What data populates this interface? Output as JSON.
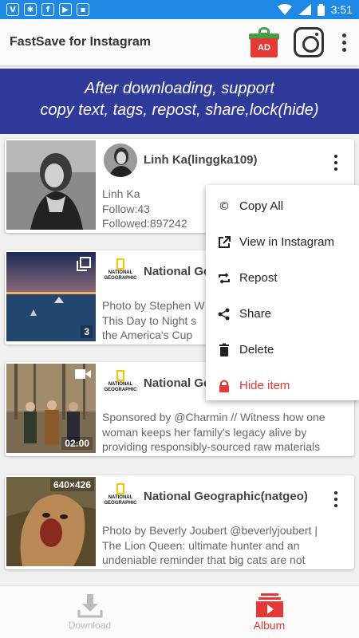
{
  "status_bar": {
    "time": "3:51"
  },
  "app_bar": {
    "title": "FastSave for Instagram",
    "gift_badge": "AD"
  },
  "banner": {
    "line1": "After downloading, support",
    "line2": "copy text, tags, repost, share,lock(hide)"
  },
  "posts": [
    {
      "user": "Linh Ka(linggka109)",
      "lines": [
        "Linh Ka",
        "Follow:43",
        "Followed:897242"
      ]
    },
    {
      "user": "National Geographic(natgeo)",
      "user_visible": "National Ge",
      "lines": [
        "Photo by Stephen W",
        "This Day to Night s",
        "the America's Cup"
      ],
      "badge": "3"
    },
    {
      "user": "National Geographic(natgeo)",
      "user_visible": "National Ge",
      "lines": [
        "Sponsored by @Charmin // Witness how one",
        "woman keeps her family's legacy alive by",
        "providing responsibly-sourced raw materials"
      ],
      "badge": "02:00"
    },
    {
      "user": "National Geographic(natgeo)",
      "lines": [
        "Photo by Beverly Joubert @beverlyjoubert |",
        "The Lion Queen:  ultimate hunter and an",
        "undeniable reminder that big cats are not"
      ],
      "badge": "640×426"
    }
  ],
  "natgeo_logo_text": "NATIONAL GEOGRAPHIC",
  "menu": {
    "items": [
      {
        "label": "Copy All",
        "icon": "copyright-icon"
      },
      {
        "label": "View in Instagram",
        "icon": "external-link-icon"
      },
      {
        "label": "Repost",
        "icon": "repost-icon"
      },
      {
        "label": "Share",
        "icon": "share-icon"
      },
      {
        "label": "Delete",
        "icon": "trash-icon"
      },
      {
        "label": "Hide item",
        "icon": "lock-icon"
      }
    ]
  },
  "bottom_nav": {
    "download": "Download",
    "album": "Album"
  },
  "colors": {
    "status_bar": "#1e88e5",
    "banner": "#303a9b",
    "accent": "#e53935"
  }
}
